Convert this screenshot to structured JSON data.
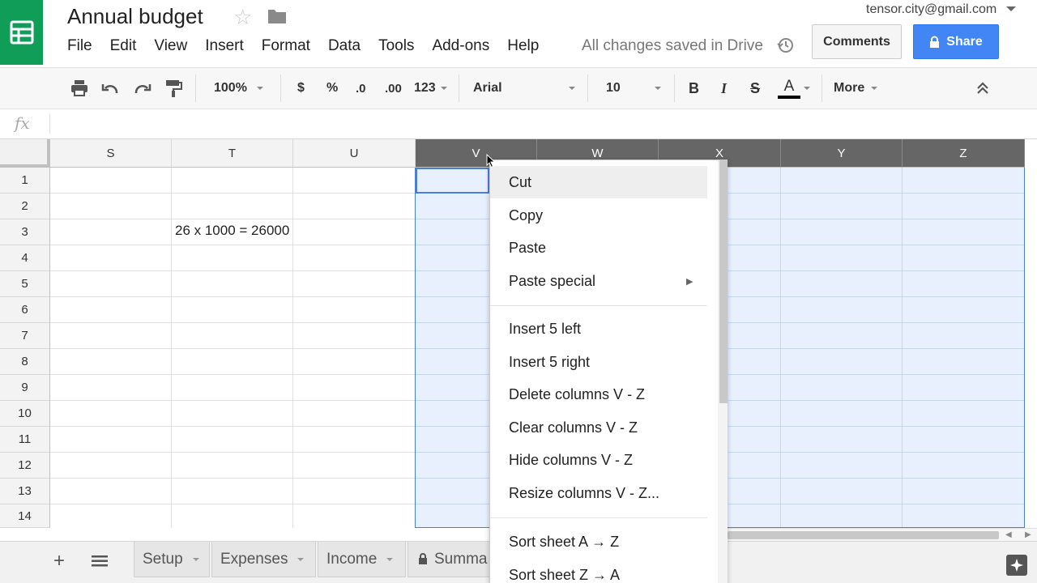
{
  "header": {
    "title": "Annual budget",
    "menu": [
      "File",
      "Edit",
      "View",
      "Insert",
      "Format",
      "Data",
      "Tools",
      "Add-ons",
      "Help"
    ],
    "save_status": "All changes saved in Drive",
    "account_email": "tensor.city@gmail.com",
    "comments_label": "Comments",
    "share_label": "Share"
  },
  "toolbar": {
    "zoom": "100%",
    "currency": "$",
    "percent": "%",
    "decrease_decimal": ".0",
    "increase_decimal": ".00",
    "more_formats": "123",
    "font": "Arial",
    "font_size": "10",
    "bold": "B",
    "italic": "I",
    "strike": "S",
    "text_color": "A",
    "more": "More"
  },
  "formula_bar": {
    "icon": "fx",
    "content": ""
  },
  "grid": {
    "columns": [
      "S",
      "T",
      "U",
      "V",
      "W",
      "X",
      "Y",
      "Z"
    ],
    "selected_columns": [
      "V",
      "W",
      "X",
      "Y",
      "Z"
    ],
    "rows": [
      "1",
      "2",
      "3",
      "4",
      "5",
      "6",
      "7",
      "8",
      "9",
      "10",
      "11",
      "12",
      "13",
      "14"
    ],
    "cell_T3": "26 x 1000 = 26000"
  },
  "context_menu": {
    "items": [
      "Cut",
      "Copy",
      "Paste",
      "Paste special",
      "Insert 5 left",
      "Insert 5 right",
      "Delete columns V - Z",
      "Clear columns V - Z",
      "Hide columns V - Z",
      "Resize columns V - Z...",
      "Sort sheet A → Z",
      "Sort sheet Z → A"
    ]
  },
  "sheets": {
    "tabs": [
      "Setup",
      "Expenses",
      "Income",
      "Summa"
    ]
  },
  "colors": {
    "brand_green": "#0f9d58",
    "share_blue": "#4285f4",
    "selection_fill": "#e8f0fe",
    "selection_border": "#4a7fd8",
    "selected_header": "#666666"
  }
}
